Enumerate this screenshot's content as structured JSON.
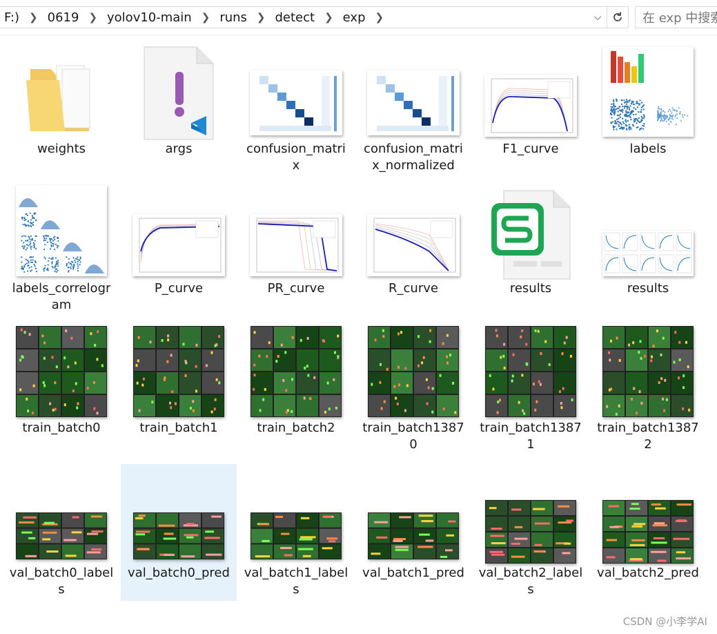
{
  "address_bar": {
    "crumbs": [
      "F:)",
      "0619",
      "yolov10-main",
      "runs",
      "detect",
      "exp"
    ],
    "search_placeholder": "在 exp 中搜索"
  },
  "files": [
    {
      "label": "weights",
      "kind": "folder"
    },
    {
      "label": "args",
      "kind": "vscode-file"
    },
    {
      "label": "confusion_matrix",
      "kind": "confusion"
    },
    {
      "label": "confusion_matrix_normalized",
      "kind": "confusion"
    },
    {
      "label": "F1_curve",
      "kind": "curve"
    },
    {
      "label": "labels",
      "kind": "labels-plot"
    },
    {
      "label": "labels_correlogram",
      "kind": "correlogram"
    },
    {
      "label": "P_curve",
      "kind": "curve"
    },
    {
      "label": "PR_curve",
      "kind": "pr-curve"
    },
    {
      "label": "R_curve",
      "kind": "curve"
    },
    {
      "label": "results",
      "kind": "spreadsheet"
    },
    {
      "label": "results",
      "kind": "results-plot"
    },
    {
      "label": "train_batch0",
      "kind": "batch-square"
    },
    {
      "label": "train_batch1",
      "kind": "batch-square"
    },
    {
      "label": "train_batch2",
      "kind": "batch-square"
    },
    {
      "label": "train_batch13870",
      "kind": "batch-square"
    },
    {
      "label": "train_batch13871",
      "kind": "batch-square"
    },
    {
      "label": "train_batch13872",
      "kind": "batch-square"
    },
    {
      "label": "val_batch0_labels",
      "kind": "batch-wide"
    },
    {
      "label": "val_batch0_pred",
      "kind": "batch-wide",
      "selected": true
    },
    {
      "label": "val_batch1_labels",
      "kind": "batch-wide"
    },
    {
      "label": "val_batch1_pred",
      "kind": "batch-wide"
    },
    {
      "label": "val_batch2_labels",
      "kind": "batch-wide"
    },
    {
      "label": "val_batch2_pred",
      "kind": "batch-wide"
    }
  ],
  "watermark": "CSDN @小李学AI"
}
